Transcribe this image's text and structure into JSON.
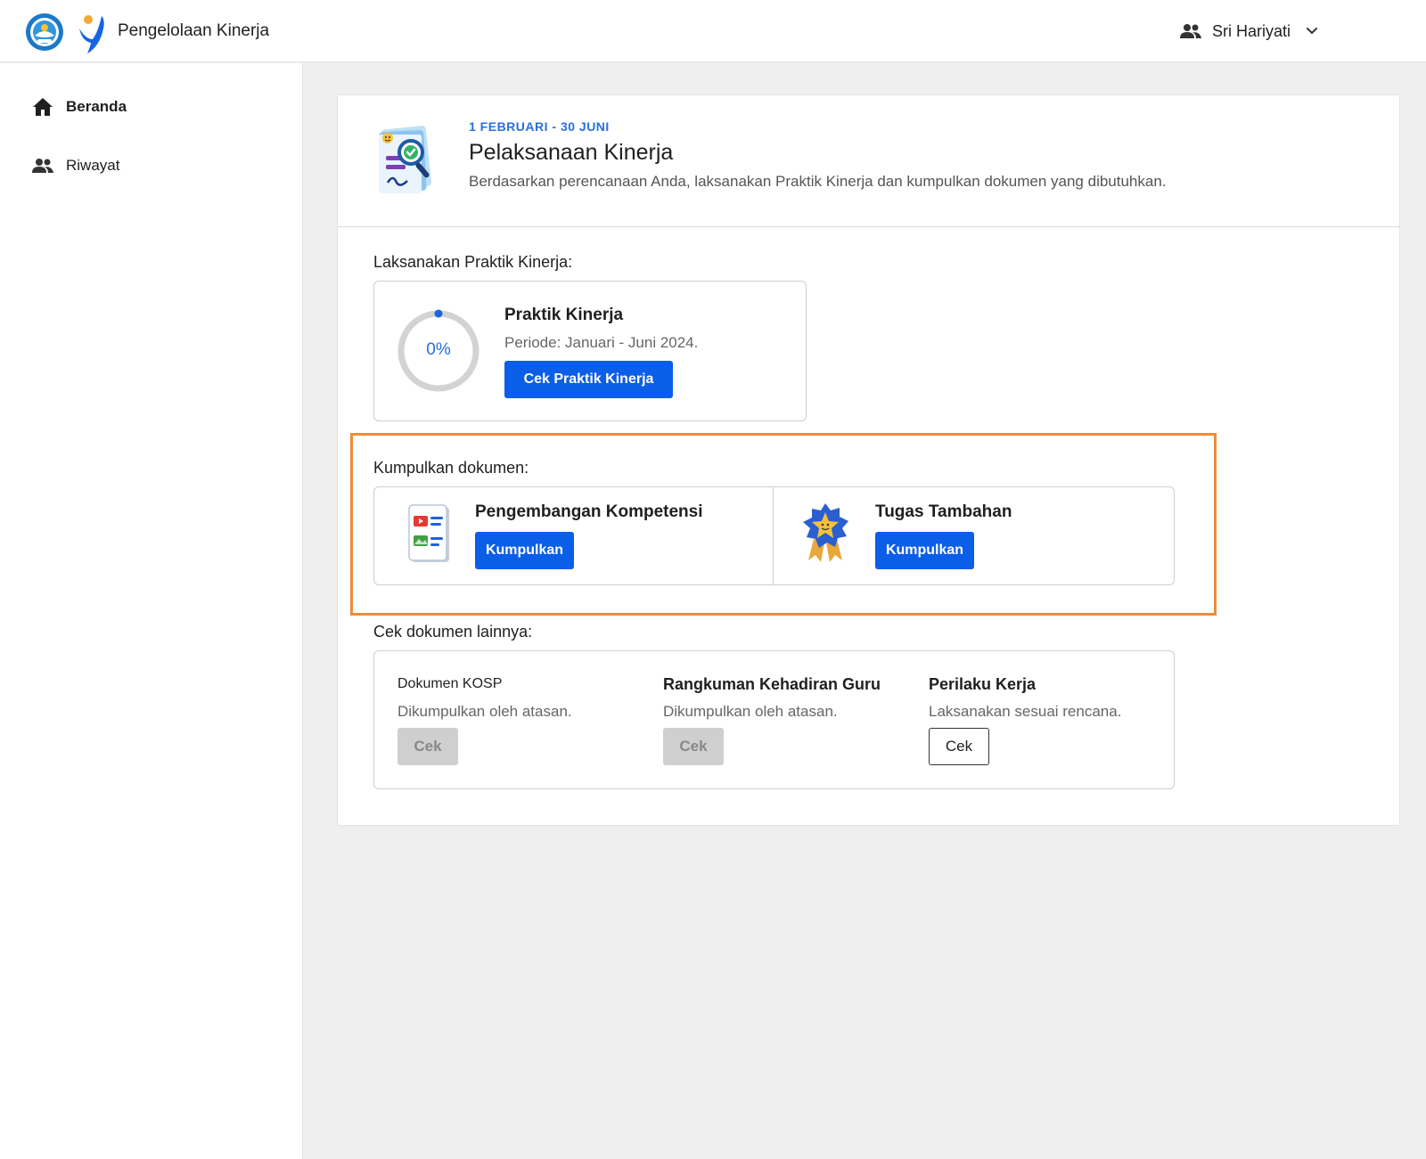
{
  "header": {
    "app_title": "Pengelolaan Kinerja",
    "user_name": "Sri Hariyati"
  },
  "sidebar": {
    "items": [
      {
        "label": "Beranda",
        "icon": "home-icon",
        "active": true
      },
      {
        "label": "Riwayat",
        "icon": "people-icon",
        "active": false
      }
    ]
  },
  "main": {
    "period": "1 FEBRUARI - 30 JUNI",
    "title": "Pelaksanaan Kinerja",
    "description": "Berdasarkan perencanaan Anda, laksanakan Praktik Kinerja dan kumpulkan dokumen yang dibutuhkan.",
    "practice_section": {
      "label": "Laksanakan Praktik Kinerja:",
      "progress_percent": 0,
      "progress_text": "0%",
      "title": "Praktik Kinerja",
      "period": "Periode: Januari - Juni 2024.",
      "button_label": "Cek Praktik Kinerja"
    },
    "collect_section": {
      "label": "Kumpulkan dokumen:",
      "items": [
        {
          "title": "Pengembangan Kompetensi",
          "icon": "document-media-icon",
          "button_label": "Kumpulkan"
        },
        {
          "title": "Tugas Tambahan",
          "icon": "star-medal-icon",
          "button_label": "Kumpulkan"
        }
      ]
    },
    "other_section": {
      "label": "Cek dokumen lainnya:",
      "items": [
        {
          "title": "Dokumen KOSP",
          "subtitle": "Dikumpulkan oleh atasan.",
          "button_label": "Cek",
          "enabled": false
        },
        {
          "title": "Rangkuman Kehadiran Guru",
          "subtitle": "Dikumpulkan oleh atasan.",
          "button_label": "Cek",
          "enabled": false
        },
        {
          "title": "Perilaku Kerja",
          "subtitle": "Laksanakan sesuai rencana.",
          "button_label": "Cek",
          "enabled": true
        }
      ]
    }
  },
  "colors": {
    "primary": "#0b5ee8",
    "accent_text": "#2a6fdb",
    "highlight_border": "#ee8d38",
    "background": "#efefef"
  }
}
